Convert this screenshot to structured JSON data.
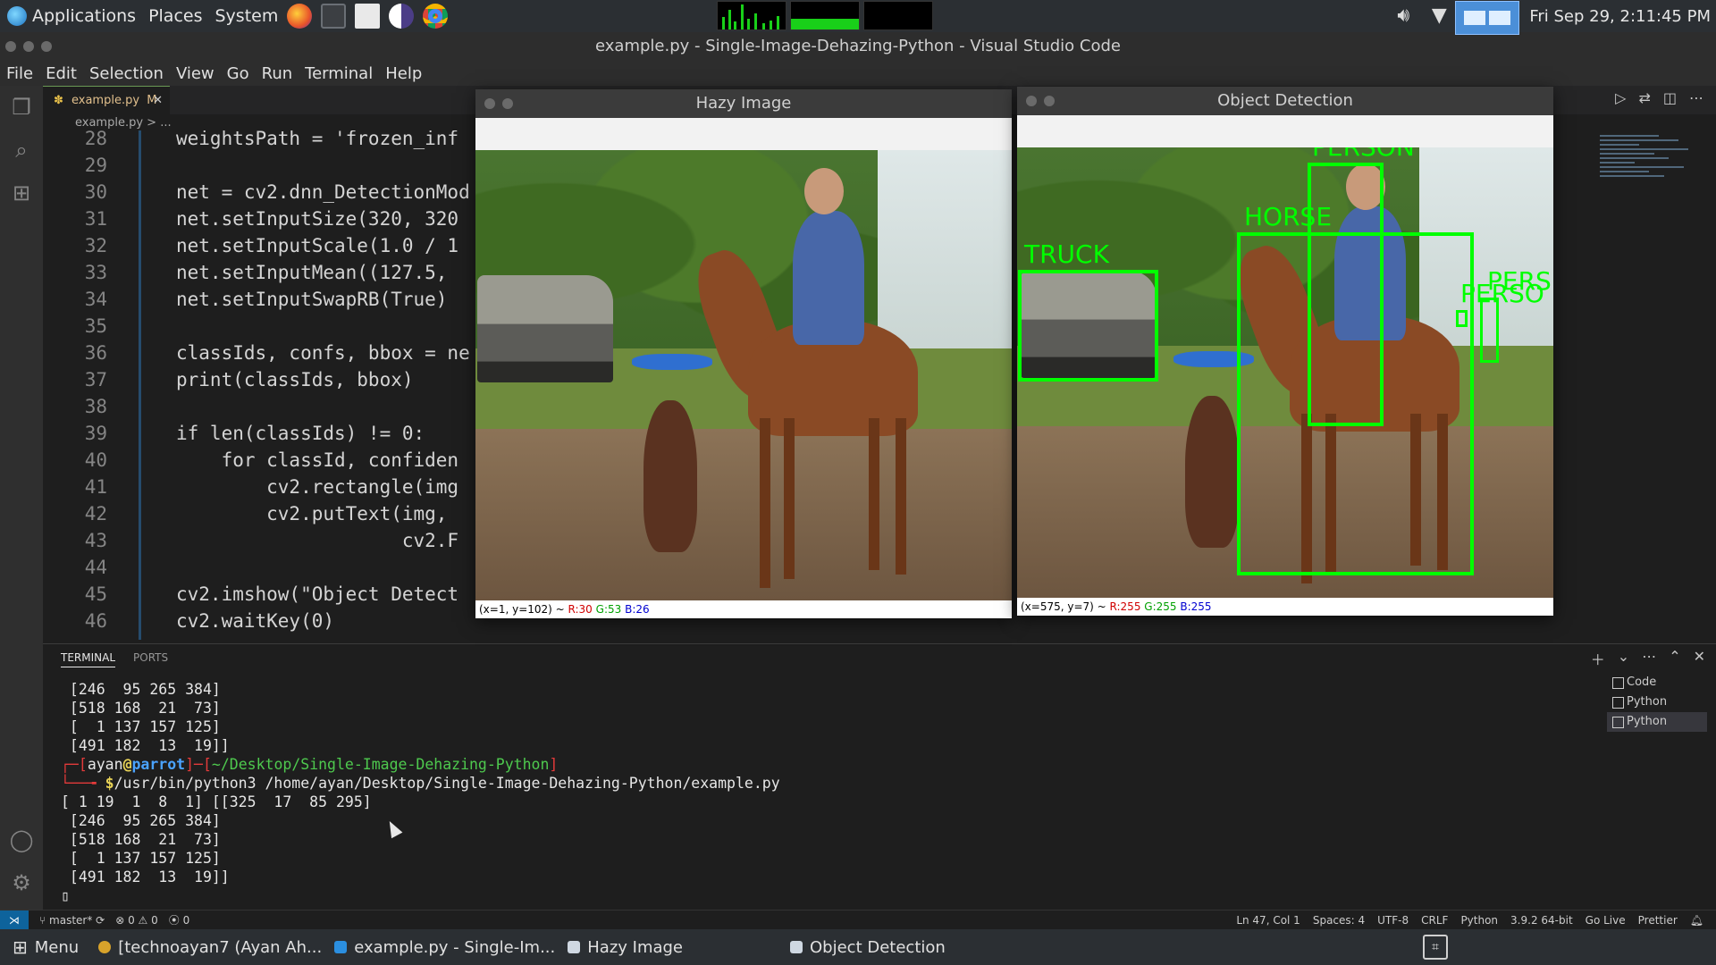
{
  "top_panel": {
    "menus": [
      "Applications",
      "Places",
      "System"
    ],
    "clock": "Fri Sep 29,  2:11:45 PM"
  },
  "window": {
    "title": "example.py - Single-Image-Dehazing-Python - Visual Studio Code"
  },
  "menubar": [
    "File",
    "Edit",
    "Selection",
    "View",
    "Go",
    "Run",
    "Terminal",
    "Help"
  ],
  "editor": {
    "tab_label": "example.py",
    "tab_status": "M",
    "breadcrumb": "example.py > ...",
    "lines": [
      {
        "n": "28",
        "t": "weightsPath = 'frozen_inf"
      },
      {
        "n": "29",
        "t": ""
      },
      {
        "n": "30",
        "t": "net = cv2.dnn_DetectionMod"
      },
      {
        "n": "31",
        "t": "net.setInputSize(320, 320"
      },
      {
        "n": "32",
        "t": "net.setInputScale(1.0 / 1"
      },
      {
        "n": "33",
        "t": "net.setInputMean((127.5,"
      },
      {
        "n": "34",
        "t": "net.setInputSwapRB(True)"
      },
      {
        "n": "35",
        "t": ""
      },
      {
        "n": "36",
        "t": "classIds, confs, bbox = ne"
      },
      {
        "n": "37",
        "t": "print(classIds, bbox)"
      },
      {
        "n": "38",
        "t": ""
      },
      {
        "n": "39",
        "t": "if len(classIds) != 0:"
      },
      {
        "n": "40",
        "t": "    for classId, confiden"
      },
      {
        "n": "41",
        "t": "        cv2.rectangle(img"
      },
      {
        "n": "42",
        "t": "        cv2.putText(img, "
      },
      {
        "n": "43",
        "t": "                    cv2.F"
      },
      {
        "n": "44",
        "t": ""
      },
      {
        "n": "45",
        "t": "cv2.imshow(\"Object Detect"
      },
      {
        "n": "46",
        "t": "cv2.waitKey(0)"
      }
    ]
  },
  "panel": {
    "tabs": [
      "TERMINAL",
      "PORTS"
    ],
    "terminal_lines": [
      " [246  95 265 384]",
      " [518 168  21  73]",
      " [  1 137 157 125]",
      " [491 182  13  19]]"
    ],
    "prompt_user": "ayan",
    "prompt_host": "parrot",
    "prompt_path": "~/Desktop/Single-Image-Dehazing-Python",
    "command": "/usr/bin/python3 /home/ayan/Desktop/Single-Image-Dehazing-Python/example.py",
    "output_lines": [
      "[ 1 19  1  8  1] [[325  17  85 295]",
      " [246  95 265 384]",
      " [518 168  21  73]",
      " [  1 137 157 125]",
      " [491 182  13  19]]"
    ],
    "terminal_instances": [
      "Code",
      "Python",
      "Python"
    ]
  },
  "statusbar": {
    "branch": "master*",
    "problems": "⊗ 0 ⚠ 0",
    "ports": "0",
    "position": "Ln 47, Col 1",
    "spaces": "Spaces: 4",
    "encoding": "UTF-8",
    "eol": "CRLF",
    "language": "Python",
    "interpreter": "3.9.2 64-bit",
    "golive": "Go Live",
    "prettier": "Prettier"
  },
  "taskbar": {
    "menu": "Menu",
    "tasks": [
      "[technoayan7 (Ayan Ah...",
      "example.py - Single-Im...",
      "Hazy Image",
      "Object Detection"
    ]
  },
  "hazy_window": {
    "title": "Hazy Image",
    "status_pos": "(x=1, y=102) ~ ",
    "status_r": "R:30",
    "status_g": "G:53",
    "status_b": "B:26"
  },
  "detection_window": {
    "title": "Object Detection",
    "status_pos": "(x=575, y=7) ~ ",
    "status_r": "R:255",
    "status_g": "G:255",
    "status_b": "B:255",
    "labels": [
      "PERSON",
      "HORSE",
      "TRUCK",
      "PERS",
      "PERSO"
    ],
    "accent": "#00ff00"
  },
  "colors": {
    "accent": "#0e639c",
    "detection_box": "#00ff00"
  }
}
